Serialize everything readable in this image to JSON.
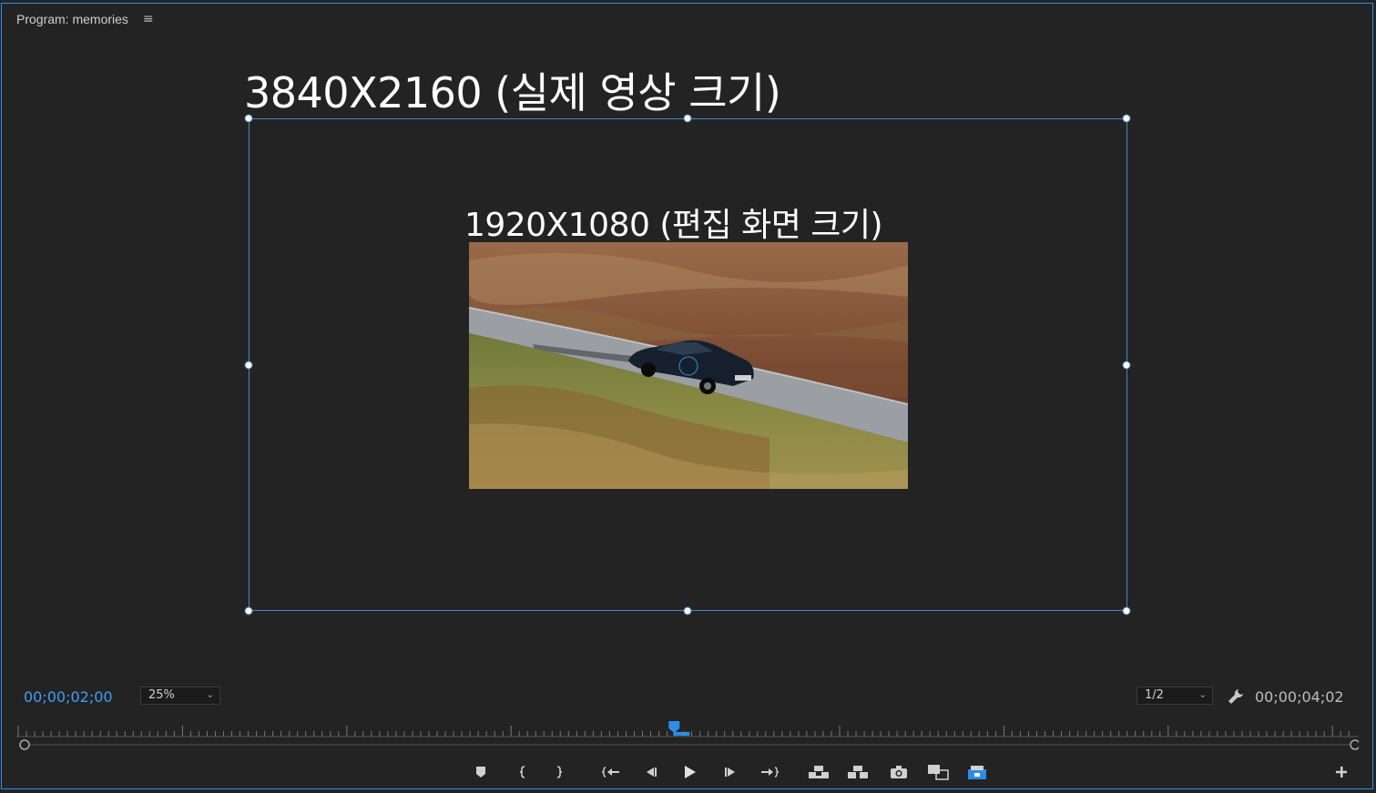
{
  "panel": {
    "title": "Program: memories",
    "menu_icon": "hamburger-icon"
  },
  "overlay": {
    "title": "3840X2160 (실제 영상 크기)",
    "subtitle": "1920X1080 (편집 화면 크기)"
  },
  "colors": {
    "accent": "#2d8ceb",
    "timecode_current": "#3d9ff5",
    "bounding_box": "#4a86c7",
    "background": "#232323"
  },
  "controls": {
    "current_timecode": "00;00;02;00",
    "zoom": "25%",
    "resolution": "1/2",
    "duration_timecode": "00;00;04;02"
  },
  "playhead": {
    "position_fraction": 0.49
  },
  "transport": {
    "buttons": [
      {
        "name": "add-marker-button",
        "icon": "marker-icon"
      },
      {
        "name": "mark-in-button",
        "icon": "mark-in-icon"
      },
      {
        "name": "mark-out-button",
        "icon": "mark-out-icon"
      },
      {
        "name": "go-to-in-button",
        "icon": "go-to-in-icon"
      },
      {
        "name": "step-back-button",
        "icon": "step-back-icon"
      },
      {
        "name": "play-button",
        "icon": "play-icon"
      },
      {
        "name": "step-forward-button",
        "icon": "step-forward-icon"
      },
      {
        "name": "go-to-out-button",
        "icon": "go-to-out-icon"
      },
      {
        "name": "lift-button",
        "icon": "lift-icon"
      },
      {
        "name": "extract-button",
        "icon": "extract-icon"
      },
      {
        "name": "export-frame-button",
        "icon": "camera-icon"
      },
      {
        "name": "comparison-view-button",
        "icon": "comparison-icon"
      },
      {
        "name": "proxy-toggle-button",
        "icon": "proxy-icon"
      },
      {
        "name": "button-editor-button",
        "icon": "plus-icon"
      }
    ]
  }
}
